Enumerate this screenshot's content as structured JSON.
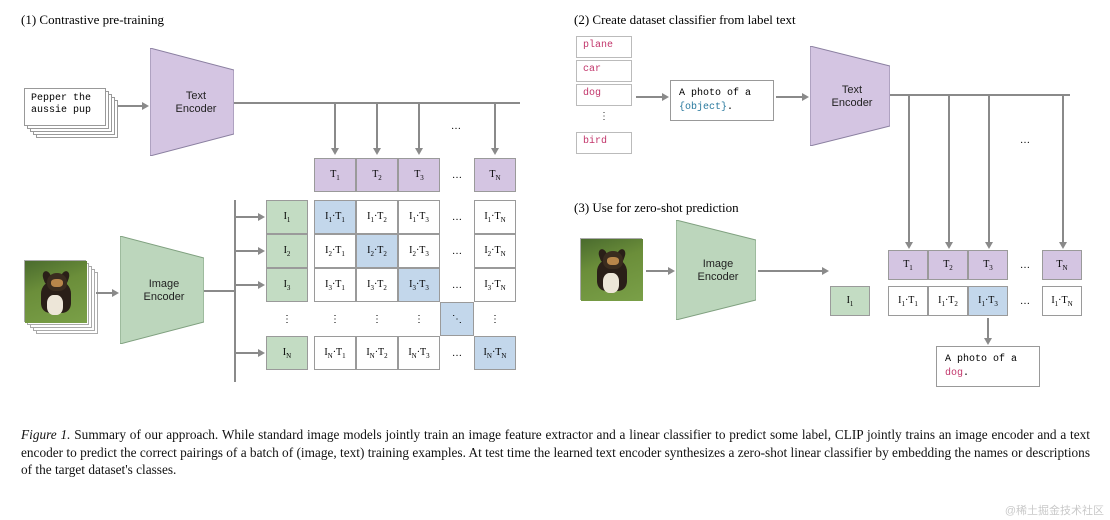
{
  "section1_title": "(1) Contrastive pre-training",
  "section2_title": "(2) Create dataset classifier from label text",
  "section3_title": "(3) Use for zero-shot prediction",
  "text_encoder_label": "Text\nEncoder",
  "image_encoder_label": "Image\nEncoder",
  "sample_caption": "Pepper the aussie pup",
  "T_header": [
    "T₁",
    "T₂",
    "T₃",
    "…",
    "T_N"
  ],
  "I_header": [
    "I₁",
    "I₂",
    "I₃",
    "⋮",
    "I_N"
  ],
  "matrix": [
    [
      "I₁·T₁",
      "I₁·T₂",
      "I₁·T₃",
      "…",
      "I₁·T_N"
    ],
    [
      "I₂·T₁",
      "I₂·T₂",
      "I₂·T₃",
      "…",
      "I₂·T_N"
    ],
    [
      "I₃·T₁",
      "I₃·T₂",
      "I₃·T₃",
      "…",
      "I₃·T_N"
    ],
    [
      "⋮",
      "⋮",
      "⋮",
      "⋱",
      "⋮"
    ],
    [
      "I_N·T₁",
      "I_N·T₂",
      "I_N·T₃",
      "…",
      "I_N·T_N"
    ]
  ],
  "class_labels": [
    "plane",
    "car",
    "dog",
    "⋮",
    "bird"
  ],
  "prompt_template_prefix": "A photo of a ",
  "prompt_template_obj": "{object}",
  "prompt_template_suffix": ".",
  "panel3_T_header": [
    "T₁",
    "T₂",
    "T₃",
    "…",
    "T_N"
  ],
  "panel3_I1": "I₁",
  "panel3_row": [
    "I₁·T₁",
    "I₁·T₂",
    "I₁·T₃",
    "…",
    "I₁·T_N"
  ],
  "result_prefix": "A photo of a ",
  "result_class": "dog",
  "result_suffix": ".",
  "panel2_dots": "…",
  "caption_lead": "Figure 1.",
  "caption_body": " Summary of our approach. While standard image models jointly train an image feature extractor and a linear classifier to predict some label, CLIP jointly trains an image encoder and a text encoder to predict the correct pairings of a batch of (image, text) training examples. At test time the learned text encoder synthesizes a zero-shot linear classifier by embedding the names or descriptions of the target dataset's classes.",
  "watermark": "@稀土掘金技术社区"
}
